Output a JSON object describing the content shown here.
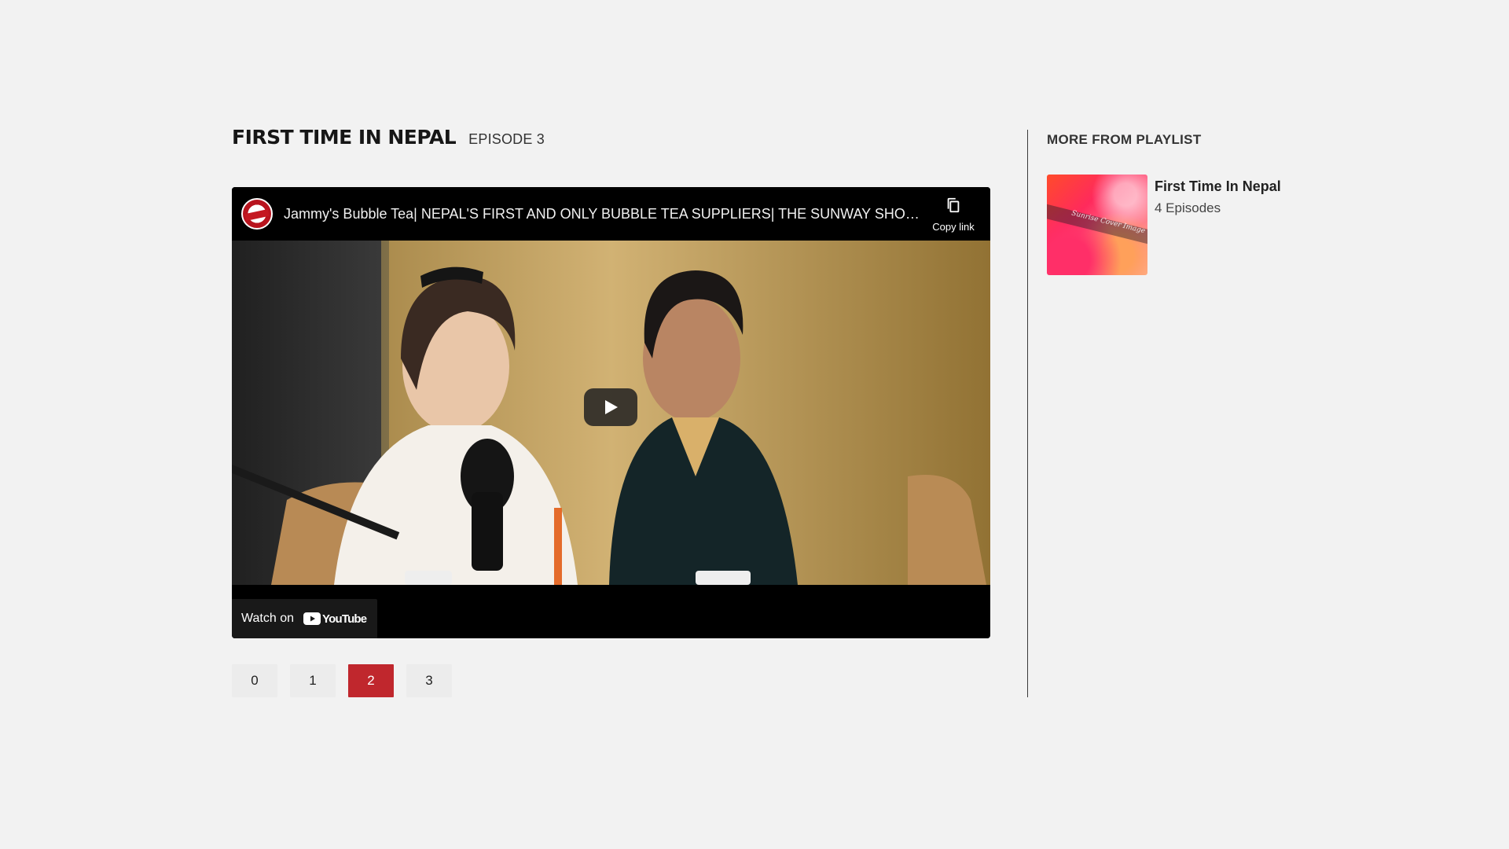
{
  "header": {
    "title": "FIRST TIME IN NEPAL",
    "episode": "EPISODE 3"
  },
  "player": {
    "video_title": "Jammy's Bubble Tea| NEPAL'S FIRST AND ONLY BUBBLE TEA SUPPLIERS| THE SUNWAY SHOW-FIRS...",
    "copy_link_label": "Copy link",
    "watch_on_label": "Watch on",
    "youtube_wordmark": "YouTube",
    "play_icon": "play-icon",
    "copy_icon": "copy-icon"
  },
  "pagination": {
    "pages": [
      "0",
      "1",
      "2",
      "3"
    ],
    "active_index": 2,
    "active_color": "#c0272d"
  },
  "sidebar": {
    "heading": "MORE FROM PLAYLIST",
    "playlist": {
      "name": "First Time In Nepal",
      "count": "4 Episodes",
      "thumb_text": "Sunrise Cover Image"
    }
  }
}
